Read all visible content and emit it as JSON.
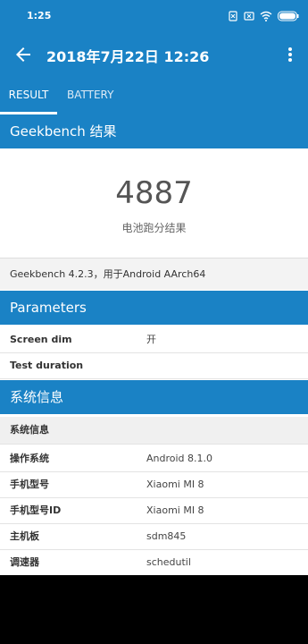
{
  "status_bar": {
    "time": "1:25"
  },
  "app_bar": {
    "title": "2018年7月22日 12:26"
  },
  "tabs": {
    "result": "RESULT",
    "battery": "BATTERY"
  },
  "geekbench": {
    "heading": "Geekbench 结果",
    "score": "4887",
    "score_label": "电池跑分结果",
    "version": "Geekbench 4.2.3，用于Android AArch64"
  },
  "parameters": {
    "heading": "Parameters",
    "rows": [
      {
        "label": "Screen dim",
        "value": "开"
      },
      {
        "label": "Test duration",
        "value": ""
      }
    ]
  },
  "system_info": {
    "heading": "系统信息",
    "group_label": "系统信息",
    "rows": [
      {
        "label": "操作系统",
        "value": "Android 8.1.0"
      },
      {
        "label": "手机型号",
        "value": "Xiaomi MI 8"
      },
      {
        "label": "手机型号ID",
        "value": "Xiaomi MI 8"
      },
      {
        "label": "主机板",
        "value": "sdm845"
      },
      {
        "label": "调速器",
        "value": "schedutil"
      }
    ]
  },
  "colors": {
    "accent": "#1a82c5",
    "background": "#ffffff"
  },
  "icons": [
    "back-arrow-icon",
    "more-vert-icon",
    "sim-icon",
    "battery-saver-icon",
    "wifi-icon",
    "battery-icon"
  ]
}
